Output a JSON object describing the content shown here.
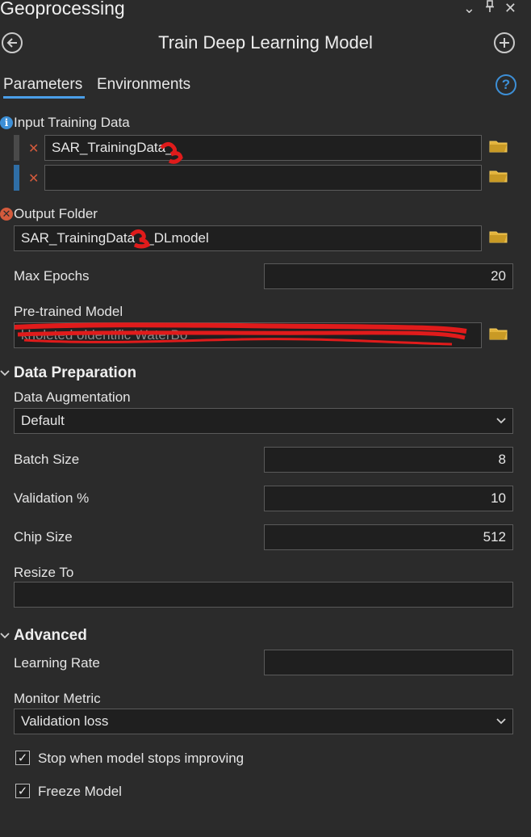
{
  "pane": {
    "title": "Geoprocessing",
    "icons": [
      "chevron-down-icon",
      "pin-icon",
      "close-icon"
    ]
  },
  "header": {
    "tool_title": "Train Deep Learning Model"
  },
  "tabs": [
    {
      "label": "Parameters",
      "active": true
    },
    {
      "label": "Environments",
      "active": false
    }
  ],
  "params": {
    "input_training_data": {
      "label": "Input Training Data",
      "rows": [
        "SAR_TrainingData_",
        ""
      ]
    },
    "output_folder": {
      "label": "Output Folder",
      "value": "SAR_TrainingData_ _DLmodel"
    },
    "max_epochs": {
      "label": "Max Epochs",
      "value": "20"
    },
    "pretrained_model": {
      "label": "Pre-trained Model",
      "value": "kholeted                 oldentific             WaterBo"
    }
  },
  "data_preparation": {
    "title": "Data Preparation",
    "data_augmentation": {
      "label": "Data Augmentation",
      "value": "Default"
    },
    "batch_size": {
      "label": "Batch Size",
      "value": "8"
    },
    "validation_pct": {
      "label": "Validation %",
      "value": "10"
    },
    "chip_size": {
      "label": "Chip Size",
      "value": "512"
    },
    "resize_to": {
      "label": "Resize To",
      "value": ""
    }
  },
  "advanced": {
    "title": "Advanced",
    "learning_rate": {
      "label": "Learning Rate",
      "value": ""
    },
    "monitor_metric": {
      "label": "Monitor Metric",
      "value": "Validation loss"
    },
    "stop_improving": {
      "label": "Stop when model stops improving",
      "checked": true
    },
    "freeze_model": {
      "label": "Freeze Model",
      "checked": true
    }
  },
  "colors": {
    "background": "#2b2b2b",
    "field": "#1f1f1f",
    "accent": "#4a9ee8",
    "error": "#d35a3c",
    "folder": "#e3b43c",
    "redaction": "#e01b1b"
  }
}
